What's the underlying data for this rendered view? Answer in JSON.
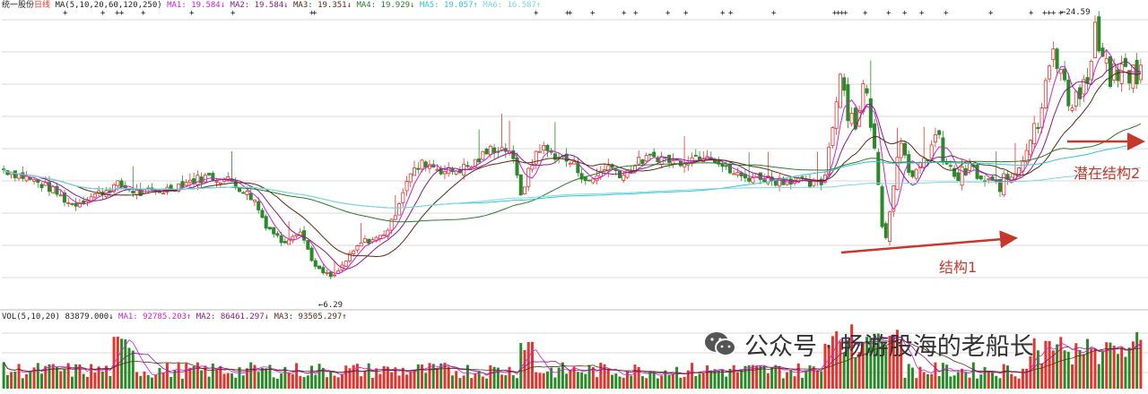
{
  "header": {
    "stock_name": "统一股份",
    "period": "日线",
    "ma_params": "MA(5,10,20,60,120,250)",
    "ma1": "MA1: 19.584↓",
    "ma2": "MA2: 19.584↓",
    "ma3": "MA3: 19.351↓",
    "ma4": "MA4: 19.929↓",
    "ma5": "MA5: 19.057↑",
    "ma6": "MA6: 16.587↑"
  },
  "vol_header": {
    "params": "VOL(5,10,20) 83879.000↓",
    "ma1": "MA1: 92785.203↑",
    "ma2": "MA2: 86461.297↓",
    "ma3": "MA3: 93505.297↑"
  },
  "labels": {
    "high": "24.59",
    "low": "6.29"
  },
  "annotations": {
    "structure1": "结构1",
    "structure2": "潜在结构2"
  },
  "watermark": {
    "text": "公众号 · 畅游股海的老船长"
  },
  "colors": {
    "up": "#e8332c",
    "down": "#2a8a2a",
    "ma1": "#d020d0",
    "ma2": "#8a1a8a",
    "ma3": "#5a2a10",
    "ma4": "#2a7a2a",
    "ma5": "#30c8d0",
    "ma6": "#7ad8e0",
    "annotation": "#c7382b",
    "grid": "#d8d8d8"
  },
  "chart_data": {
    "type": "candlestick",
    "price_range": [
      6.29,
      24.59
    ],
    "close_path": [
      [
        0,
        14.4
      ],
      [
        0.02,
        13.8
      ],
      [
        0.04,
        13.1
      ],
      [
        0.06,
        11.9
      ],
      [
        0.08,
        12.6
      ],
      [
        0.1,
        13.3
      ],
      [
        0.12,
        12.7
      ],
      [
        0.14,
        12.9
      ],
      [
        0.16,
        13.5
      ],
      [
        0.18,
        13.9
      ],
      [
        0.2,
        13.6
      ],
      [
        0.22,
        12.3
      ],
      [
        0.23,
        10.6
      ],
      [
        0.245,
        9.3
      ],
      [
        0.26,
        10.2
      ],
      [
        0.275,
        7.4
      ],
      [
        0.29,
        6.8
      ],
      [
        0.3,
        7.9
      ],
      [
        0.315,
        9.3
      ],
      [
        0.33,
        9.6
      ],
      [
        0.34,
        10.4
      ],
      [
        0.355,
        13.8
      ],
      [
        0.37,
        14.9
      ],
      [
        0.39,
        14.2
      ],
      [
        0.41,
        14.6
      ],
      [
        0.43,
        15.9
      ],
      [
        0.445,
        15.8
      ],
      [
        0.455,
        12.7
      ],
      [
        0.47,
        16.0
      ],
      [
        0.485,
        15.4
      ],
      [
        0.5,
        14.8
      ],
      [
        0.515,
        13.4
      ],
      [
        0.53,
        14.7
      ],
      [
        0.545,
        14.0
      ],
      [
        0.56,
        15.0
      ],
      [
        0.575,
        15.3
      ],
      [
        0.59,
        14.9
      ],
      [
        0.605,
        15.2
      ],
      [
        0.62,
        15.6
      ],
      [
        0.635,
        14.4
      ],
      [
        0.65,
        13.8
      ],
      [
        0.665,
        13.9
      ],
      [
        0.68,
        13.6
      ],
      [
        0.695,
        13.7
      ],
      [
        0.71,
        13.3
      ],
      [
        0.72,
        13.4
      ],
      [
        0.728,
        16.8
      ],
      [
        0.735,
        21.6
      ],
      [
        0.742,
        18.7
      ],
      [
        0.75,
        17.5
      ],
      [
        0.755,
        20.4
      ],
      [
        0.762,
        18.3
      ],
      [
        0.77,
        12.6
      ],
      [
        0.775,
        9.2
      ],
      [
        0.78,
        12.4
      ],
      [
        0.79,
        16.9
      ],
      [
        0.8,
        13.4
      ],
      [
        0.81,
        15.0
      ],
      [
        0.82,
        16.8
      ],
      [
        0.83,
        14.4
      ],
      [
        0.84,
        13.8
      ],
      [
        0.85,
        14.5
      ],
      [
        0.86,
        13.6
      ],
      [
        0.87,
        13.2
      ],
      [
        0.88,
        13.5
      ],
      [
        0.89,
        14.3
      ],
      [
        0.9,
        16.1
      ],
      [
        0.91,
        18.0
      ],
      [
        0.92,
        22.6
      ],
      [
        0.93,
        21.1
      ],
      [
        0.935,
        19.2
      ],
      [
        0.945,
        19.7
      ],
      [
        0.955,
        20.9
      ],
      [
        0.96,
        23.9
      ],
      [
        0.968,
        21.4
      ],
      [
        0.975,
        20.8
      ],
      [
        0.985,
        21.3
      ],
      [
        0.995,
        21.1
      ]
    ]
  }
}
